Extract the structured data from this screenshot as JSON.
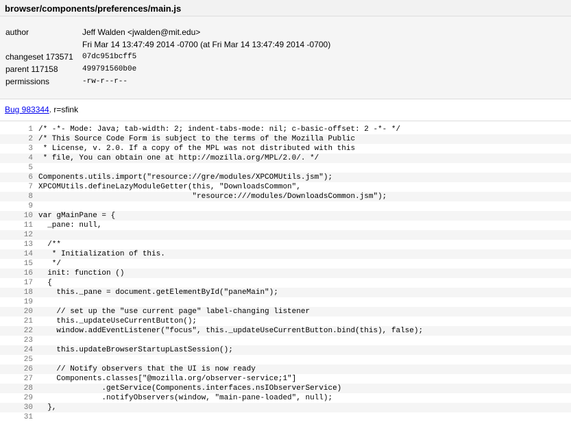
{
  "file_path": "browser/components/preferences/main.js",
  "meta": {
    "author_label": "author",
    "author_name": "Jeff Walden <jwalden@mit.edu>",
    "author_date": "Fri Mar 14 13:47:49 2014 -0700 (at Fri Mar 14 13:47:49 2014 -0700)",
    "changeset_label": "changeset 173571",
    "changeset_value": "07dc951bcff5",
    "parent_label": "parent 117158",
    "parent_value": "499791560b0e",
    "permissions_label": "permissions",
    "permissions_value": "-rw-r--r--"
  },
  "description": {
    "bug_link": "Bug 983344",
    "rest": ". r=sfink"
  },
  "code_lines": [
    {
      "num": "1",
      "text": "/* -*- Mode: Java; tab-width: 2; indent-tabs-mode: nil; c-basic-offset: 2 -*- */"
    },
    {
      "num": "2",
      "text": "/* This Source Code Form is subject to the terms of the Mozilla Public"
    },
    {
      "num": "3",
      "text": " * License, v. 2.0. If a copy of the MPL was not distributed with this"
    },
    {
      "num": "4",
      "text": " * file, You can obtain one at http://mozilla.org/MPL/2.0/. */"
    },
    {
      "num": "5",
      "text": ""
    },
    {
      "num": "6",
      "text": "Components.utils.import(\"resource://gre/modules/XPCOMUtils.jsm\");"
    },
    {
      "num": "7",
      "text": "XPCOMUtils.defineLazyModuleGetter(this, \"DownloadsCommon\","
    },
    {
      "num": "8",
      "text": "                                  \"resource:///modules/DownloadsCommon.jsm\");"
    },
    {
      "num": "9",
      "text": ""
    },
    {
      "num": "10",
      "text": "var gMainPane = {"
    },
    {
      "num": "11",
      "text": "  _pane: null,"
    },
    {
      "num": "12",
      "text": ""
    },
    {
      "num": "13",
      "text": "  /**"
    },
    {
      "num": "14",
      "text": "   * Initialization of this."
    },
    {
      "num": "15",
      "text": "   */"
    },
    {
      "num": "16",
      "text": "  init: function ()"
    },
    {
      "num": "17",
      "text": "  {"
    },
    {
      "num": "18",
      "text": "    this._pane = document.getElementById(\"paneMain\");"
    },
    {
      "num": "19",
      "text": ""
    },
    {
      "num": "20",
      "text": "    // set up the \"use current page\" label-changing listener"
    },
    {
      "num": "21",
      "text": "    this._updateUseCurrentButton();"
    },
    {
      "num": "22",
      "text": "    window.addEventListener(\"focus\", this._updateUseCurrentButton.bind(this), false);"
    },
    {
      "num": "23",
      "text": ""
    },
    {
      "num": "24",
      "text": "    this.updateBrowserStartupLastSession();"
    },
    {
      "num": "25",
      "text": ""
    },
    {
      "num": "26",
      "text": "    // Notify observers that the UI is now ready"
    },
    {
      "num": "27",
      "text": "    Components.classes[\"@mozilla.org/observer-service;1\"]"
    },
    {
      "num": "28",
      "text": "              .getService(Components.interfaces.nsIObserverService)"
    },
    {
      "num": "29",
      "text": "              .notifyObservers(window, \"main-pane-loaded\", null);"
    },
    {
      "num": "30",
      "text": "  },"
    },
    {
      "num": "31",
      "text": ""
    }
  ]
}
